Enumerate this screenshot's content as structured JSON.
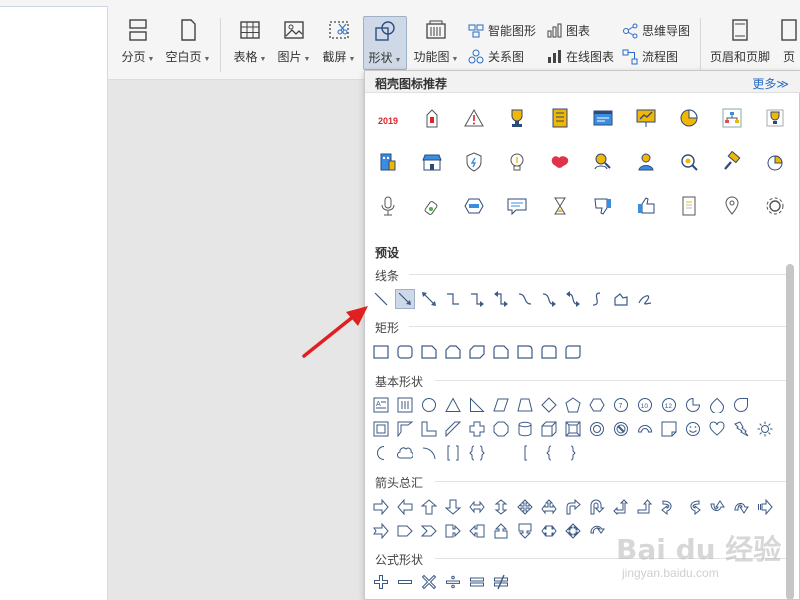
{
  "ribbon": {
    "large_buttons": [
      {
        "label": "分页",
        "icon": "page-break-icon",
        "caret": true
      },
      {
        "label": "空白页",
        "icon": "blank-page-icon",
        "caret": true
      },
      {
        "label": "表格",
        "icon": "table-icon",
        "caret": true
      },
      {
        "label": "图片",
        "icon": "picture-icon",
        "caret": true
      },
      {
        "label": "截屏",
        "icon": "screenshot-icon",
        "caret": true
      },
      {
        "label": "形状",
        "icon": "shape-icon",
        "caret": true,
        "active": true
      },
      {
        "label": "功能图",
        "icon": "function-chart-icon",
        "caret": true
      },
      {
        "label": "页眉和页脚",
        "icon": "header-footer-icon",
        "caret": false
      },
      {
        "label": "页",
        "icon": "page-icon",
        "caret": false
      }
    ],
    "small_buttons": [
      {
        "label": "智能图形",
        "icon": "smart-art-icon"
      },
      {
        "label": "图表",
        "icon": "chart-icon"
      },
      {
        "label": "思维导图",
        "icon": "mind-map-icon"
      },
      {
        "label": "关系图",
        "icon": "relationship-icon"
      },
      {
        "label": "在线图表",
        "icon": "online-chart-icon"
      },
      {
        "label": "流程图",
        "icon": "flowchart-icon"
      }
    ]
  },
  "panel": {
    "title": "稻壳图标推荐",
    "more": "更多≫",
    "recommended_icons": [
      "badge-2019-icon",
      "lantern-icon",
      "warning-icon",
      "trophy-icon",
      "notebook-icon",
      "browser-window-icon",
      "presentation-board-icon",
      "pie-chart-icon",
      "org-chart-icon",
      "award-icon",
      "building-icon",
      "shop-icon",
      "shield-icon",
      "lightbulb-icon",
      "map-icon",
      "people-search-icon",
      "user-icon",
      "magnifier-icon",
      "hammer-icon",
      "pie-slice-icon",
      "microphone-icon",
      "usb-drive-icon",
      "hexagon-icon",
      "chat-bubble-icon",
      "hourglass-icon",
      "thumb-down-icon",
      "thumb-up-icon",
      "document-icon",
      "location-pin-icon",
      "gear-icon"
    ],
    "recommended_text": "2019",
    "presets_label": "预设",
    "categories": {
      "lines": "线条",
      "rectangles": "矩形",
      "basic": "基本形状",
      "arrows": "箭头总汇",
      "equations": "公式形状"
    },
    "basic_shape_numbers": [
      "7",
      "10",
      "12"
    ]
  },
  "watermark": {
    "brand": "Bai du 经验",
    "url": "jingyan.baidu.com"
  },
  "colors": {
    "accent": "#2b6cc4",
    "shape_stroke": "#3d5a85",
    "arrow": "#e02020"
  }
}
